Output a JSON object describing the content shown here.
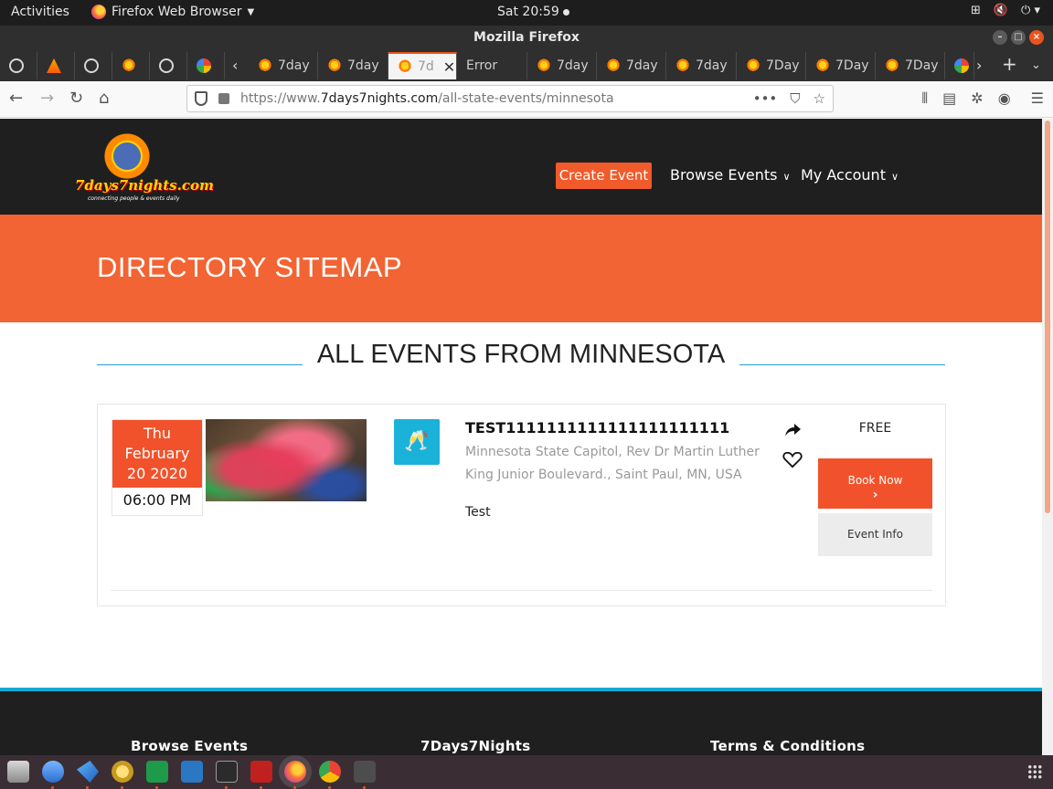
{
  "desktop": {
    "activities": "Activities",
    "app_name": "Firefox Web Browser",
    "clock": "Sat 20:59"
  },
  "window": {
    "title": "Mozilla Firefox"
  },
  "tabs": [
    {
      "label": "",
      "icon": "globe-icon"
    },
    {
      "label": "",
      "icon": "sun-icon"
    },
    {
      "label": "",
      "icon": "globe-icon"
    },
    {
      "label": "",
      "icon": "7days-icon"
    },
    {
      "label": "",
      "icon": "globe-icon"
    },
    {
      "label": "",
      "icon": "google-icon"
    },
    {
      "label": "7day",
      "icon": "7days-icon"
    },
    {
      "label": "7day",
      "icon": "7days-icon"
    },
    {
      "label": "7d",
      "icon": "7days-icon",
      "active": true
    },
    {
      "label": "Error",
      "icon": ""
    },
    {
      "label": "7day",
      "icon": "7days-icon"
    },
    {
      "label": "7day",
      "icon": "7days-icon"
    },
    {
      "label": "7day",
      "icon": "7days-icon"
    },
    {
      "label": "7Day",
      "icon": "7days-icon"
    },
    {
      "label": "7Day",
      "icon": "7days-icon"
    },
    {
      "label": "7Day",
      "icon": "7days-icon"
    }
  ],
  "navbar": {
    "url_prefix": "https://www.",
    "url_domain": "7days7nights.com",
    "url_path": "/all-state-events/minnesota"
  },
  "site": {
    "create_event": "Create Event",
    "browse_events": "Browse Events",
    "my_account": "My Account",
    "banner_title": "DIRECTORY SITEMAP",
    "section_title": "ALL EVENTS FROM MINNESOTA"
  },
  "event": {
    "weekday": "Thu",
    "month": "February",
    "day_year": "20 2020",
    "time": "06:00 PM",
    "title": "TEST1111111111111111111111",
    "address": "Minnesota State Capitol, Rev Dr Martin Luther King Junior Boulevard., Saint Paul, MN, USA",
    "description": "Test",
    "price": "FREE",
    "book_now": "Book Now",
    "event_info": "Event Info"
  },
  "footer": {
    "col1": "Browse Events",
    "col2": "7Days7Nights",
    "col3": "Terms & Conditions"
  },
  "colors": {
    "brand_orange": "#f26433",
    "accent_blue": "#17a9d2",
    "header_dark": "#1f1f1f"
  }
}
